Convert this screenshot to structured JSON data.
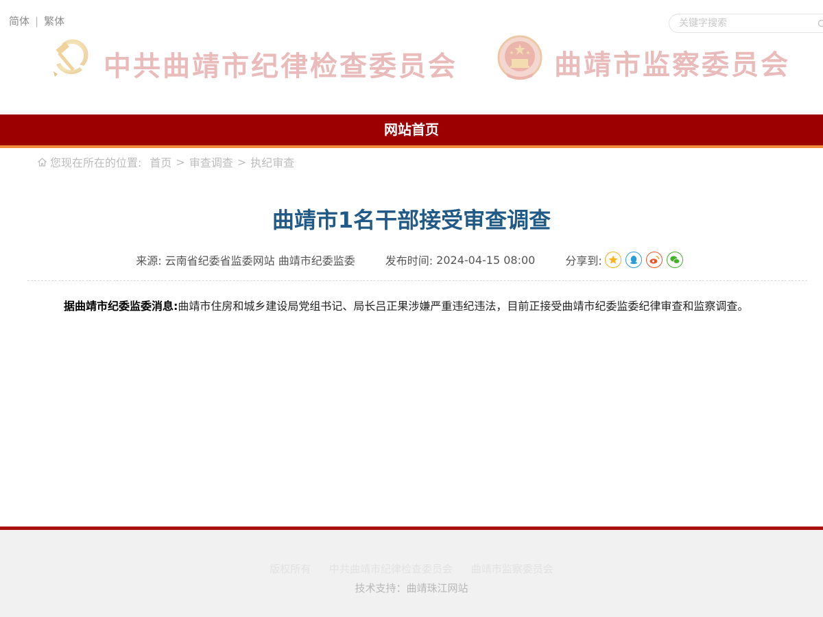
{
  "top_bar": {
    "lang_simplified": "简体",
    "lang_separator": "|",
    "lang_traditional": "繁体",
    "search_placeholder": "关键字搜索"
  },
  "header": {
    "left_title": "中共曲靖市纪律检查委员会",
    "right_title": "曲靖市监察委员会"
  },
  "nav": {
    "home": "网站首页"
  },
  "breadcrumb": {
    "prefix": "您现在所在的位置:",
    "items": [
      "首页",
      "审查调查",
      "执纪审查"
    ],
    "separator": ">"
  },
  "article": {
    "title": "曲靖市1名干部接受审查调查",
    "source_label": "来源:",
    "source": "云南省纪委省监委网站 曲靖市纪委监委",
    "publish_label": "发布时间:",
    "publish_time": "2024-04-15 08:00",
    "share_label": "分享到:",
    "lead": "据曲靖市纪委监委消息:",
    "body": "曲靖市住房和城乡建设局党组书记、局长吕正果涉嫌严重违纪违法，目前正接受曲靖市纪委监委纪律审查和监察调查。"
  },
  "share_icons": [
    "star-icon",
    "qq-icon",
    "weibo-icon",
    "wechat-icon"
  ],
  "footer": {
    "copyright": "版权所有",
    "org1": "中共曲靖市纪律检查委员会",
    "org2": "曲靖市监察委员会",
    "tech_support": "技术支持：曲靖珠江网站"
  },
  "colors": {
    "nav_bg": "#9c0000",
    "nav_underline": "#f08a3c",
    "title": "#215a87",
    "banner_text": "#e9bcbb",
    "footer_line": "#a80f0f"
  }
}
